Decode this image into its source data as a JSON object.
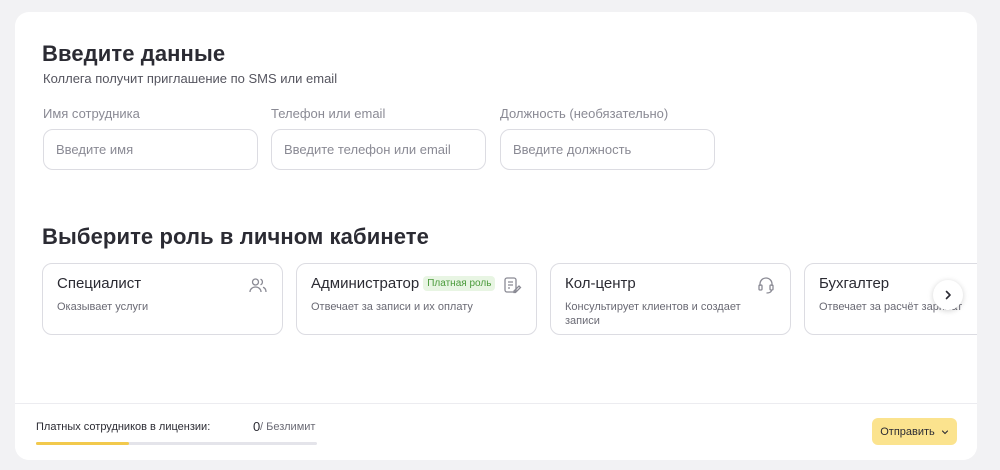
{
  "data_section": {
    "title": "Введите данные",
    "subtitle": "Коллега получит приглашение по SMS или email",
    "fields": [
      {
        "label": "Имя сотрудника",
        "placeholder": "Введите имя"
      },
      {
        "label": "Телефон или email",
        "placeholder": "Введите телефон или email"
      },
      {
        "label": "Должность (необязательно)",
        "placeholder": "Введите должность"
      }
    ]
  },
  "role_section": {
    "title": "Выберите роль в личном кабинете",
    "roles": [
      {
        "title": "Специалист",
        "description": "Оказывает услуги",
        "icon": "users-icon"
      },
      {
        "title": "Администратор",
        "badge": "Платная роль",
        "description": "Отвечает за записи и их оплату",
        "icon": "clipboard-edit-icon"
      },
      {
        "title": "Кол-центр",
        "description": "Консультирует клиентов и создает записи",
        "icon": "headset-icon"
      },
      {
        "title": "Бухгалтер",
        "description": "Отвечает за расчёт зарплат"
      }
    ],
    "next_icon": "chevron-right-icon"
  },
  "footer": {
    "license_label": "Платных сотрудников в лицензии:",
    "license_count": "0",
    "license_limit": "/ Безлимит",
    "progress": 0.33,
    "send_label": "Отправить"
  },
  "colors": {
    "accent_yellow": "#fbe38e",
    "progress_yellow": "#f2c94c",
    "badge_green": "#4a9a3a",
    "badge_bg": "#e8f5e3"
  }
}
